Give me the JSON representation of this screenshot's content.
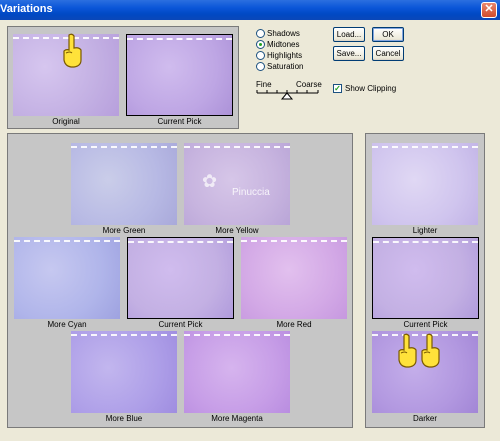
{
  "window": {
    "title": "Variations",
    "close_glyph": "✕"
  },
  "top": {
    "original_label": "Original",
    "current_pick_label": "Current Pick"
  },
  "options": {
    "shadows": "Shadows",
    "midtones": "Midtones",
    "highlights": "Highlights",
    "saturation": "Saturation",
    "selected": "midtones",
    "fine": "Fine",
    "coarse": "Coarse",
    "show_clipping": "Show Clipping",
    "show_clipping_checked": true,
    "check_glyph": "✓"
  },
  "buttons": {
    "load": "Load...",
    "ok": "OK",
    "save": "Save...",
    "cancel": "Cancel"
  },
  "grid": {
    "more_green": "More Green",
    "more_yellow": "More Yellow",
    "more_cyan": "More Cyan",
    "current_pick": "Current Pick",
    "more_red": "More Red",
    "more_blue": "More Blue",
    "more_magenta": "More Magenta",
    "watermark": "Pinuccia"
  },
  "lightness": {
    "lighter": "Lighter",
    "current_pick": "Current Pick",
    "darker": "Darker"
  },
  "colors": {
    "titlebar": "#0a55d8",
    "panel": "#c6c6c6",
    "dialog": "#ECE9D8",
    "base": "#c3b0e3",
    "more_green": "#b7b9e4",
    "more_yellow": "#c7b4df",
    "more_cyan": "#b0b5ea",
    "more_red": "#d3a9e6",
    "more_blue": "#ae9fe8",
    "more_magenta": "#c79ee7",
    "lighter": "#d0c5ee",
    "darker": "#b298e0"
  },
  "icons": {
    "hand": "pointing-hand-icon"
  }
}
